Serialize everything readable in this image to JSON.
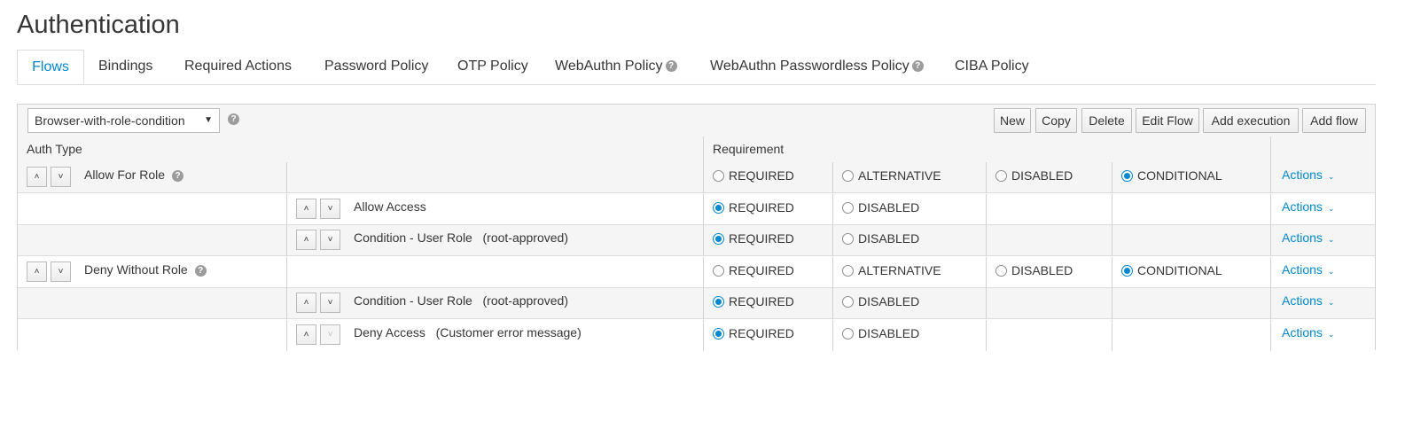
{
  "page": {
    "title": "Authentication"
  },
  "tabs": [
    {
      "label": "Flows",
      "active": true
    },
    {
      "label": "Bindings"
    },
    {
      "label": "Required Actions"
    },
    {
      "label": "Password Policy"
    },
    {
      "label": "OTP Policy"
    },
    {
      "label": "WebAuthn Policy",
      "help": true
    },
    {
      "label": "WebAuthn Passwordless Policy",
      "help": true
    },
    {
      "label": "CIBA Policy"
    }
  ],
  "toolbar": {
    "flow_select_value": "Browser-with-role-condition",
    "buttons": [
      "New",
      "Copy",
      "Delete",
      "Edit Flow",
      "Add execution",
      "Add flow"
    ]
  },
  "table": {
    "headers": {
      "auth_type": "Auth Type",
      "requirement": "Requirement"
    },
    "actions_label": "Actions",
    "rows": [
      {
        "level": 0,
        "name": "Allow For Role",
        "help": true,
        "options": [
          "REQUIRED",
          "ALTERNATIVE",
          "DISABLED",
          "CONDITIONAL"
        ],
        "selected": "CONDITIONAL"
      },
      {
        "level": 1,
        "name": "Allow Access",
        "options": [
          "REQUIRED",
          "DISABLED"
        ],
        "selected": "REQUIRED"
      },
      {
        "level": 1,
        "name": "Condition - User Role   (root-approved)",
        "options": [
          "REQUIRED",
          "DISABLED"
        ],
        "selected": "REQUIRED"
      },
      {
        "level": 0,
        "name": "Deny Without Role",
        "help": true,
        "options": [
          "REQUIRED",
          "ALTERNATIVE",
          "DISABLED",
          "CONDITIONAL"
        ],
        "selected": "CONDITIONAL"
      },
      {
        "level": 1,
        "name": "Condition - User Role   (root-approved)",
        "options": [
          "REQUIRED",
          "DISABLED"
        ],
        "selected": "REQUIRED"
      },
      {
        "level": 1,
        "name": "Deny Access   (Customer error message)",
        "down_disabled": true,
        "options": [
          "REQUIRED",
          "DISABLED"
        ],
        "selected": "REQUIRED"
      }
    ]
  },
  "icons": {
    "help": "question-circle-icon",
    "up": "chevron-up-icon",
    "down": "chevron-down-icon",
    "select_caret": "caret-down-icon"
  },
  "colors": {
    "link": "#0088ce",
    "radio_checked": "#0088ce"
  }
}
